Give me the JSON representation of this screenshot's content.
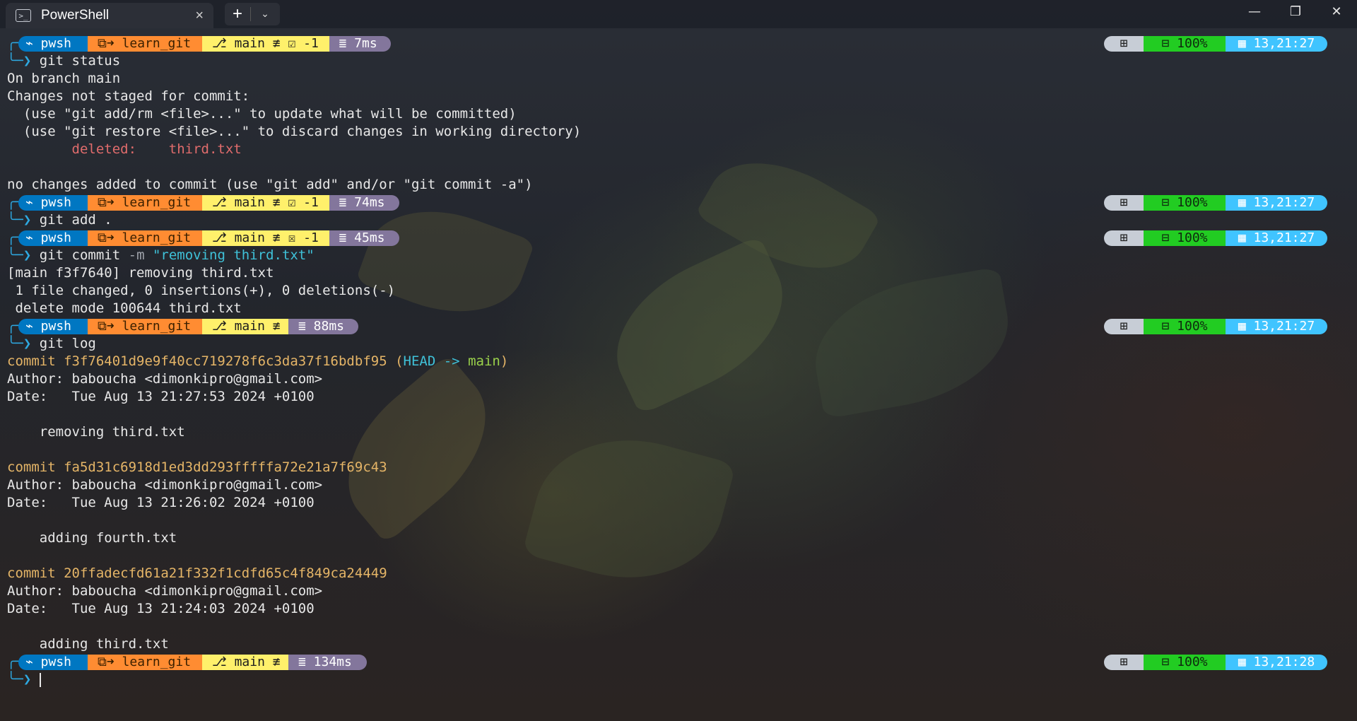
{
  "window": {
    "tab_title": "PowerShell",
    "tab_icon": "terminal-icon",
    "close_tab": "×",
    "new_tab": "+",
    "dropdown": "⌄",
    "minimize": "—",
    "restore": "❐",
    "close": "✕"
  },
  "colors": {
    "pwsh_seg": "#0077c2",
    "path_seg": "#ff8c32",
    "git_seg": "#fff06b",
    "time_seg": "#83769c",
    "os_seg": "#c7cdd6",
    "battery_seg": "#22cc22",
    "clock_seg": "#40c4ff"
  },
  "prompt_text": {
    "shell": "⌁ pwsh",
    "path": "⧉➜ learn_git",
    "os": "⊞",
    "battery": "⊟ 100%",
    "prefix_top": "╭─",
    "prefix_bottom": "╰─❯"
  },
  "prompts": [
    {
      "git": "⎇ main ≢ ☑ -1",
      "time": "≣ 7ms",
      "clock": "▦ 13,21:27",
      "command": "git status"
    },
    {
      "git": "⎇ main ≢ ☑ -1",
      "time": "≣ 74ms",
      "clock": "▦ 13,21:27",
      "command": "git add ."
    },
    {
      "git": "⎇ main ≢ ☒ -1",
      "time": "≣ 45ms",
      "clock": "▦ 13,21:27",
      "command_parts": [
        "git commit ",
        "-m ",
        "\"removing third.txt\""
      ]
    },
    {
      "git": "⎇ main ≢",
      "time": "≣ 88ms",
      "clock": "▦ 13,21:27",
      "command": "git log"
    },
    {
      "git": "⎇ main ≢",
      "time": "≣ 134ms",
      "clock": "▦ 13,21:28",
      "command": ""
    }
  ],
  "status_output": [
    "On branch main",
    "Changes not staged for commit:",
    "  (use \"git add/rm <file>...\" to update what will be committed)",
    "  (use \"git restore <file>...\" to discard changes in working directory)",
    "        deleted:    third.txt",
    "",
    "no changes added to commit (use \"git add\" and/or \"git commit -a\")"
  ],
  "commit_output": [
    "[main f3f7640] removing third.txt",
    " 1 file changed, 0 insertions(+), 0 deletions(-)",
    " delete mode 100644 third.txt"
  ],
  "log_output": {
    "head_commit": "commit f3f76401d9e9f40cc719278f6c3da37f16bdbf95",
    "head_ref_open": " (",
    "head_ref_head": "HEAD",
    "head_ref_arrow": " -> ",
    "head_ref_main": "main",
    "head_ref_close": ")",
    "lines1": [
      "Author: babouchа <dimonkipro@gmail.com>",
      "Date:   Tue Aug 13 21:27:53 2024 +0100",
      "",
      "    removing third.txt",
      ""
    ],
    "commit2": "commit fa5d31c6918d1ed3dd293fffffa72e21a7f69c43",
    "lines2": [
      "Author: babouchа <dimonkipro@gmail.com>",
      "Date:   Tue Aug 13 21:26:02 2024 +0100",
      "",
      "    adding fourth.txt",
      ""
    ],
    "commit3": "commit 20ffadecfd61a21f332f1cdfd65c4f849ca24449",
    "lines3": [
      "Author: babouchа <dimonkipro@gmail.com>",
      "Date:   Tue Aug 13 21:24:03 2024 +0100",
      "",
      "    adding third.txt"
    ]
  }
}
